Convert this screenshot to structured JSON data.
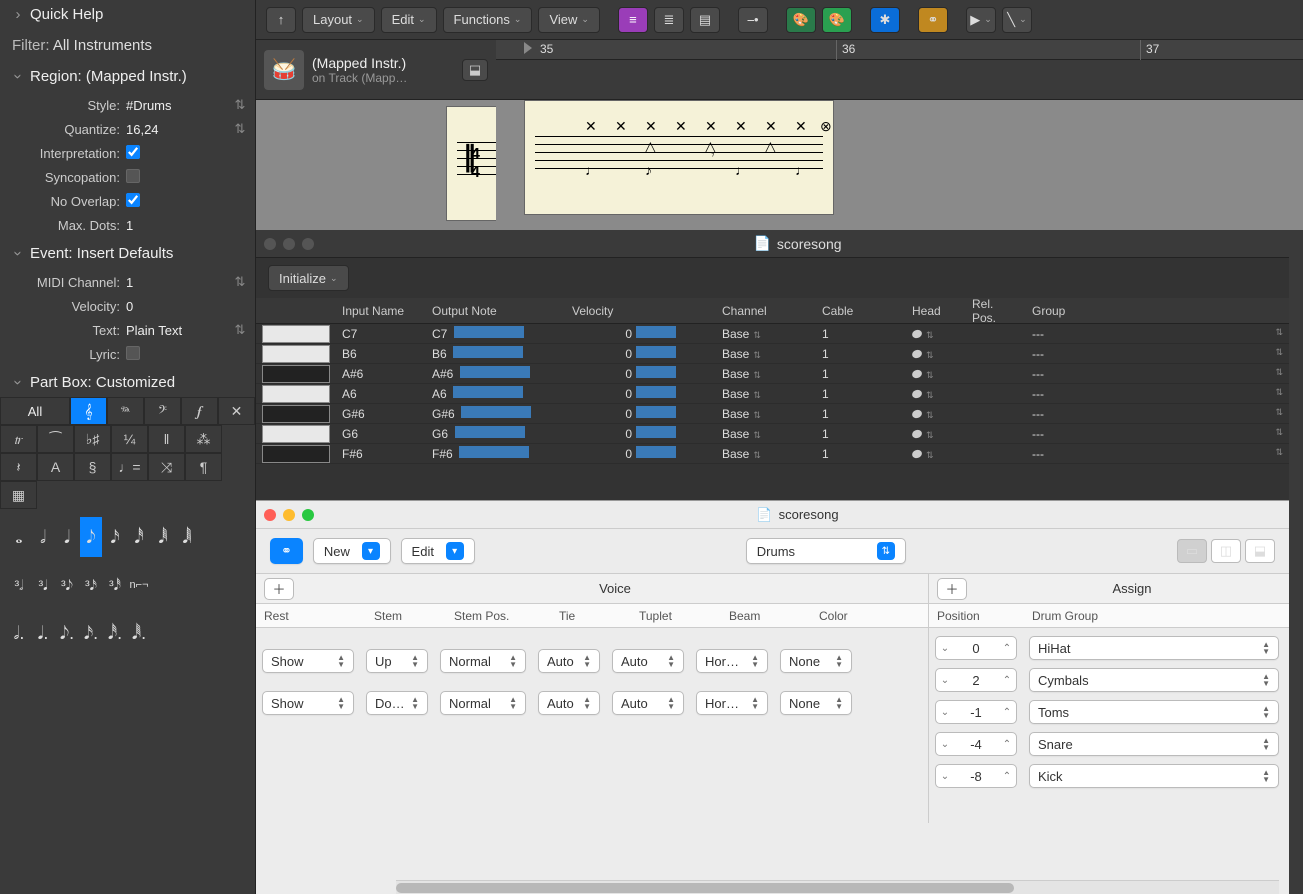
{
  "sidebar": {
    "quick_help": "Quick Help",
    "filter_label": "Filter:",
    "filter_value": "All Instruments",
    "region_label": "Region:",
    "region_value": "(Mapped Instr.)",
    "style_k": "Style:",
    "style_v": "#Drums",
    "quantize_k": "Quantize:",
    "quantize_v": "16,24",
    "interp_k": "Interpretation:",
    "interp_v": true,
    "sync_k": "Syncopation:",
    "sync_v": false,
    "overlap_k": "No Overlap:",
    "overlap_v": true,
    "dots_k": "Max. Dots:",
    "dots_v": "1",
    "event_label": "Event:",
    "event_value": "Insert Defaults",
    "midi_k": "MIDI Channel:",
    "midi_v": "1",
    "vel_k": "Velocity:",
    "vel_v": "0",
    "text_k": "Text:",
    "text_v": "Plain Text",
    "lyric_k": "Lyric:",
    "partbox_label": "Part Box:",
    "partbox_value": "Customized",
    "pb_all": "All"
  },
  "toolbar": {
    "layout": "Layout",
    "edit": "Edit",
    "functions": "Functions",
    "view": "View"
  },
  "track": {
    "name": "(Mapped Instr.)",
    "sub": "on Track (Mapp…"
  },
  "ruler": {
    "m35": "35",
    "m36": "36",
    "m37": "37"
  },
  "mapwin": {
    "title": "scoresong",
    "initialize": "Initialize",
    "hdr_input": "Input Name",
    "hdr_output": "Output Note",
    "hdr_vel": "Velocity",
    "hdr_ch": "Channel",
    "hdr_cable": "Cable",
    "hdr_head": "Head",
    "hdr_rel": "Rel. Pos.",
    "hdr_grp": "Group",
    "rows": [
      {
        "in": "C7",
        "out": "C7",
        "vel": "0",
        "ch": "Base",
        "cable": "1",
        "grp": "---",
        "black": false
      },
      {
        "in": "B6",
        "out": "B6",
        "vel": "0",
        "ch": "Base",
        "cable": "1",
        "grp": "---",
        "black": false
      },
      {
        "in": "A#6",
        "out": "A#6",
        "vel": "0",
        "ch": "Base",
        "cable": "1",
        "grp": "---",
        "black": true
      },
      {
        "in": "A6",
        "out": "A6",
        "vel": "0",
        "ch": "Base",
        "cable": "1",
        "grp": "---",
        "black": false
      },
      {
        "in": "G#6",
        "out": "G#6",
        "vel": "0",
        "ch": "Base",
        "cable": "1",
        "grp": "---",
        "black": true
      },
      {
        "in": "G6",
        "out": "G6",
        "vel": "0",
        "ch": "Base",
        "cable": "1",
        "grp": "---",
        "black": false
      },
      {
        "in": "F#6",
        "out": "F#6",
        "vel": "0",
        "ch": "Base",
        "cable": "1",
        "grp": "---",
        "black": true
      }
    ]
  },
  "stylewin": {
    "title": "scoresong",
    "link": "⚭",
    "new": "New",
    "edit": "Edit",
    "style": "Drums",
    "voice_title": "Voice",
    "assign_title": "Assign",
    "vcols": {
      "rest": "Rest",
      "stem": "Stem",
      "stempos": "Stem Pos.",
      "tie": "Tie",
      "tuplet": "Tuplet",
      "beam": "Beam",
      "color": "Color"
    },
    "acols": {
      "pos": "Position",
      "grp": "Drum Group"
    },
    "vrows": [
      {
        "rest": "Show",
        "stem": "Up",
        "stempos": "Normal",
        "tie": "Auto",
        "tuplet": "Auto",
        "beam": "Hor…",
        "color": "None"
      },
      {
        "rest": "Show",
        "stem": "Do…",
        "stempos": "Normal",
        "tie": "Auto",
        "tuplet": "Auto",
        "beam": "Hor…",
        "color": "None"
      }
    ],
    "arows": [
      {
        "pos": "0",
        "grp": "HiHat"
      },
      {
        "pos": "2",
        "grp": "Cymbals"
      },
      {
        "pos": "-1",
        "grp": "Toms"
      },
      {
        "pos": "-4",
        "grp": "Snare"
      },
      {
        "pos": "-8",
        "grp": "Kick"
      }
    ]
  }
}
